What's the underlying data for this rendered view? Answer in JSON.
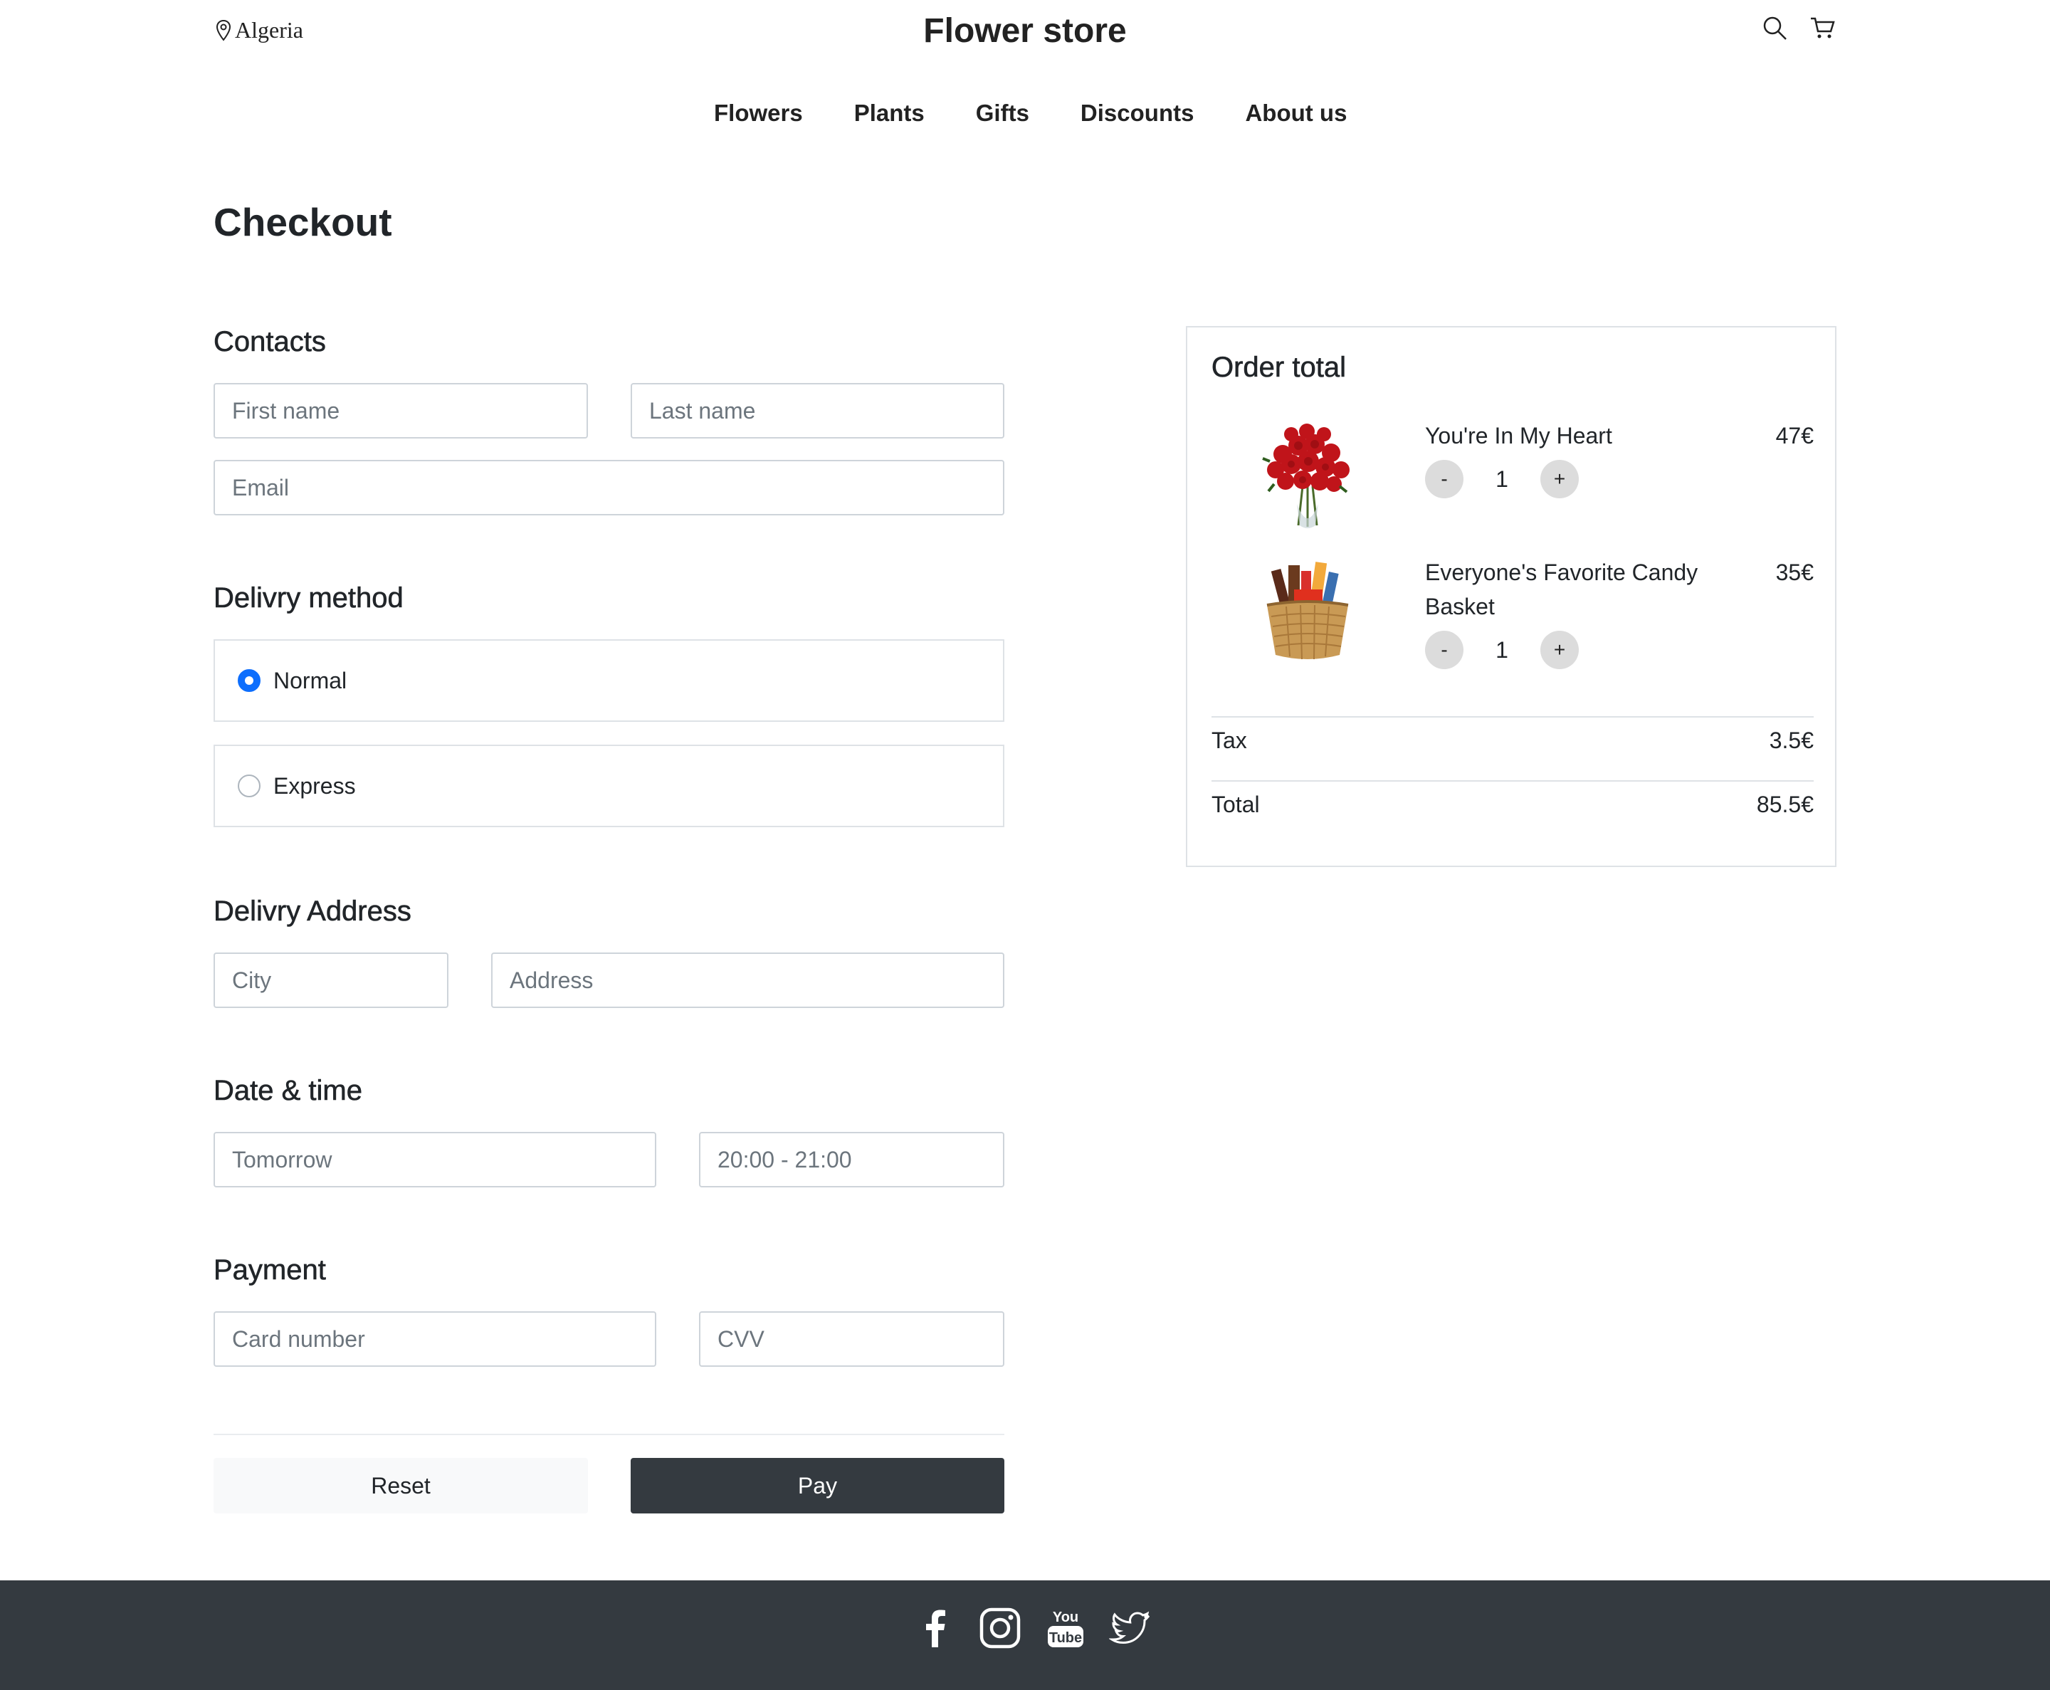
{
  "header": {
    "location": "Algeria",
    "brand": "Flower store",
    "nav": [
      "Flowers",
      "Plants",
      "Gifts",
      "Discounts",
      "About us"
    ]
  },
  "page_title": "Checkout",
  "contacts": {
    "title": "Contacts",
    "first_name_placeholder": "First name",
    "last_name_placeholder": "Last name",
    "email_placeholder": "Email"
  },
  "delivery_method": {
    "title": "Delivry method",
    "options": [
      {
        "label": "Normal",
        "checked": true
      },
      {
        "label": "Express",
        "checked": false
      }
    ]
  },
  "delivery_address": {
    "title": "Delivry Address",
    "city_placeholder": "City",
    "address_placeholder": "Address"
  },
  "date_time": {
    "title": "Date & time",
    "date_placeholder": "Tomorrow",
    "time_placeholder": "20:00 - 21:00"
  },
  "payment": {
    "title": "Payment",
    "card_placeholder": "Card number",
    "cvv_placeholder": "CVV"
  },
  "actions": {
    "reset_label": "Reset",
    "pay_label": "Pay"
  },
  "order": {
    "title": "Order total",
    "items": [
      {
        "name": "You're In My Heart",
        "price": "47€",
        "qty": "1",
        "image": "red-roses-bouquet"
      },
      {
        "name": "Everyone's Favorite Candy Basket",
        "price": "35€",
        "qty": "1",
        "image": "candy-basket"
      }
    ],
    "minus_label": "-",
    "plus_label": "+",
    "tax_label": "Tax",
    "tax_value": "3.5€",
    "total_label": "Total",
    "total_value": "85.5€"
  },
  "footer": {
    "social": [
      "facebook-icon",
      "instagram-icon",
      "youtube-icon",
      "twitter-icon"
    ],
    "youtube_you": "You",
    "youtube_tube": "Tube"
  },
  "colors": {
    "accent": "#0d6efd",
    "dark": "#343a40",
    "border": "#ced4da"
  }
}
